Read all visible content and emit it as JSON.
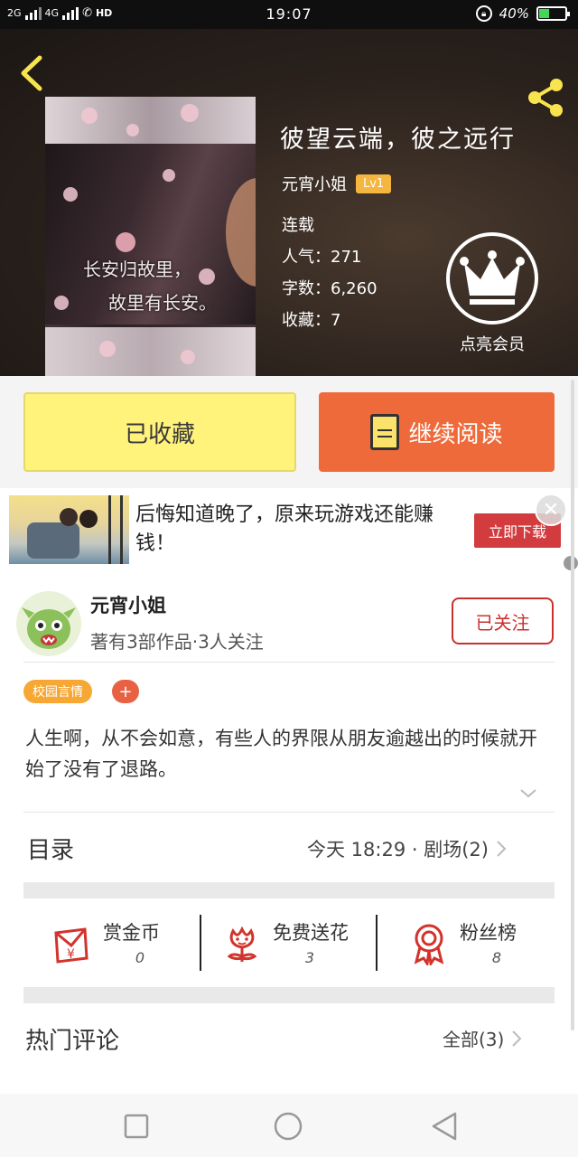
{
  "status_bar": {
    "network_left": "2G",
    "network_right": "4G",
    "hd": "HD",
    "time": "19:07",
    "battery_percent": "40%",
    "battery_level": 0.4
  },
  "book": {
    "title": "彼望云端，彼之远行",
    "author": "元宵小姐",
    "level": "Lv1",
    "status": "连载",
    "popularity": "人气：271",
    "word_count": "字数：6,260",
    "favorites": "收藏：7",
    "vip_label": "点亮会员",
    "cover_line1": "长安归故里，",
    "cover_line2": "故里有长安。"
  },
  "actions": {
    "favorited_label": "已收藏",
    "continue_label": "继续阅读"
  },
  "ad": {
    "text": "后悔知道晚了，原来玩游戏还能赚钱！",
    "button": "立即下载"
  },
  "author_card": {
    "name": "元宵小姐",
    "subtitle": "著有3部作品·3人关注",
    "follow_button": "已关注"
  },
  "tags": {
    "items": [
      "校园言情"
    ],
    "add": "+"
  },
  "description": "人生啊，从不会如意，有些人的界限从朋友逾越出的时候就开始了没有了退路。",
  "toc": {
    "title": "目录",
    "latest": "今天 18:29 · 剧场(2)"
  },
  "stats": [
    {
      "label": "赏金币",
      "value": "0",
      "icon": "coin-envelope-icon"
    },
    {
      "label": "免费送花",
      "value": "3",
      "icon": "flower-icon"
    },
    {
      "label": "粉丝榜",
      "value": "8",
      "icon": "medal-icon"
    }
  ],
  "comments": {
    "title": "热门评论",
    "all": "全部(3)"
  },
  "colors": {
    "favorite_button": "#fff37c",
    "read_button": "#ee6a3a",
    "follow_accent": "#c8322c",
    "tag": "#f7a733",
    "ad_button": "#d23c3f",
    "lv_badge": "#f4b63e"
  }
}
